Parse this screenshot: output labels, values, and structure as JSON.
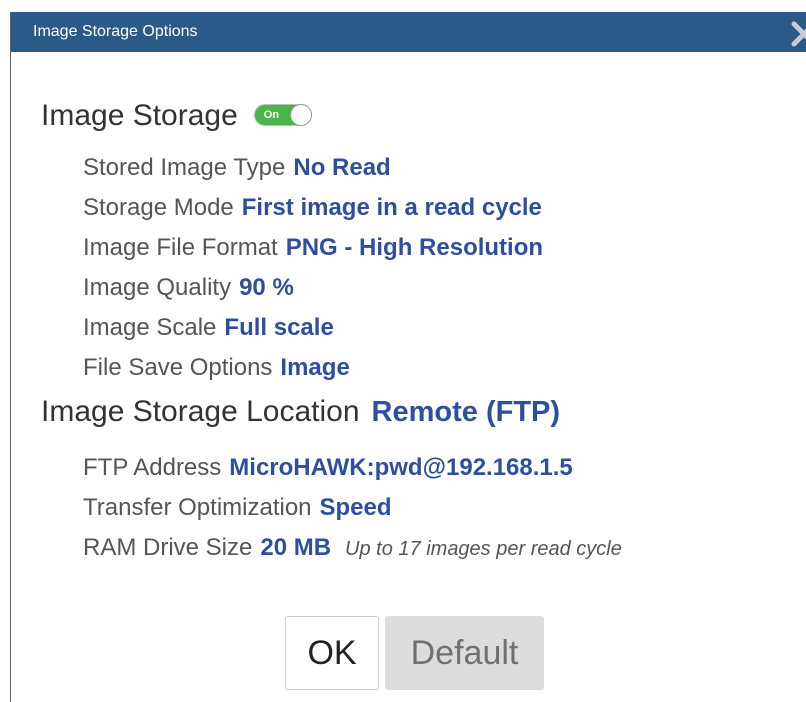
{
  "dialog": {
    "title": "Image Storage Options"
  },
  "image_storage": {
    "heading": "Image Storage",
    "toggle_label": "On",
    "toggle_state": "on",
    "toggle_color": "#4ab54a"
  },
  "settings": {
    "stored_image_type": {
      "label": "Stored Image Type",
      "value": "No Read"
    },
    "storage_mode": {
      "label": "Storage Mode",
      "value": "First image in a read cycle"
    },
    "image_file_format": {
      "label": "Image File Format",
      "value": "PNG - High Resolution"
    },
    "image_quality": {
      "label": "Image Quality",
      "value": "90 %"
    },
    "image_scale": {
      "label": "Image Scale",
      "value": "Full scale"
    },
    "file_save_options": {
      "label": "File Save Options",
      "value": "Image"
    }
  },
  "location": {
    "heading": "Image Storage Location",
    "value": "Remote (FTP)",
    "ftp_address": {
      "label": "FTP Address",
      "value": "MicroHAWK:pwd@192.168.1.5"
    },
    "transfer_optimization": {
      "label": "Transfer Optimization",
      "value": "Speed"
    },
    "ram_drive_size": {
      "label": "RAM Drive Size",
      "value": "20 MB",
      "note": "Up to 17 images per read cycle"
    }
  },
  "buttons": {
    "ok_label": "OK",
    "default_label": "Default"
  },
  "colors": {
    "titlebar": "#2b5a88",
    "value_text": "#2e4fa0",
    "label_text": "#555555"
  },
  "icons": {
    "close": "close-icon"
  }
}
